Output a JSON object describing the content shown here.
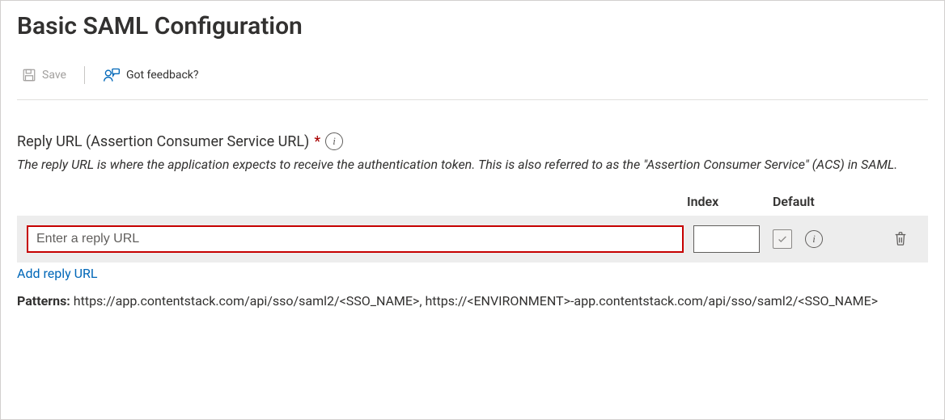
{
  "header": {
    "title": "Basic SAML Configuration"
  },
  "toolbar": {
    "save_label": "Save",
    "feedback_label": "Got feedback?"
  },
  "section": {
    "label": "Reply URL (Assertion Consumer Service URL)",
    "required_mark": "*",
    "help_text": "The reply URL is where the application expects to receive the authentication token. This is also referred to as the \"Assertion Consumer Service\" (ACS) in SAML."
  },
  "columns": {
    "index": "Index",
    "default": "Default"
  },
  "rows": [
    {
      "url_placeholder": "Enter a reply URL",
      "url_value": "",
      "index_value": "",
      "is_default": false
    }
  ],
  "add_link_label": "Add reply URL",
  "patterns": {
    "label": "Patterns:",
    "text": " https://app.contentstack.com/api/sso/saml2/<SSO_NAME>, https://<ENVIRONMENT>-app.contentstack.com/api/sso/saml2/<SSO_NAME>"
  }
}
